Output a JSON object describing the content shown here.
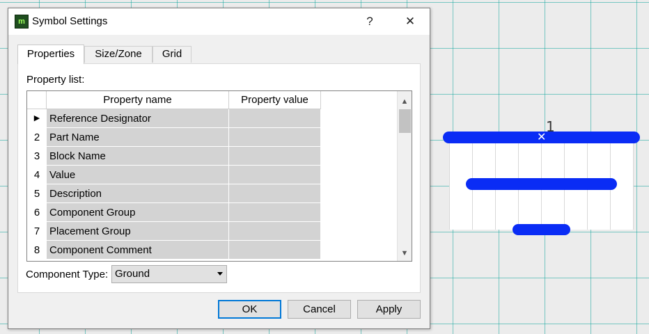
{
  "dialog": {
    "title": "Symbol Settings",
    "help_label": "?",
    "close_label": "✕",
    "app_icon_label": "m"
  },
  "tabs": [
    {
      "label": "Properties",
      "active": true
    },
    {
      "label": "Size/Zone",
      "active": false
    },
    {
      "label": "Grid",
      "active": false
    }
  ],
  "properties": {
    "list_label": "Property list:",
    "columns": [
      "Property name",
      "Property value"
    ],
    "rows": [
      {
        "index": "▶",
        "name": "Reference Designator",
        "value": ""
      },
      {
        "index": "2",
        "name": "Part Name",
        "value": ""
      },
      {
        "index": "3",
        "name": "Block Name",
        "value": ""
      },
      {
        "index": "4",
        "name": "Value",
        "value": ""
      },
      {
        "index": "5",
        "name": "Description",
        "value": ""
      },
      {
        "index": "6",
        "name": "Component Group",
        "value": ""
      },
      {
        "index": "7",
        "name": "Placement Group",
        "value": ""
      },
      {
        "index": "8",
        "name": "Component Comment",
        "value": ""
      }
    ]
  },
  "component_type": {
    "label": "Component Type:",
    "selected": "Ground"
  },
  "buttons": {
    "ok": "OK",
    "cancel": "Cancel",
    "apply": "Apply"
  },
  "canvas": {
    "pin_number": "1",
    "symbol_color": "#0a2cf5"
  }
}
